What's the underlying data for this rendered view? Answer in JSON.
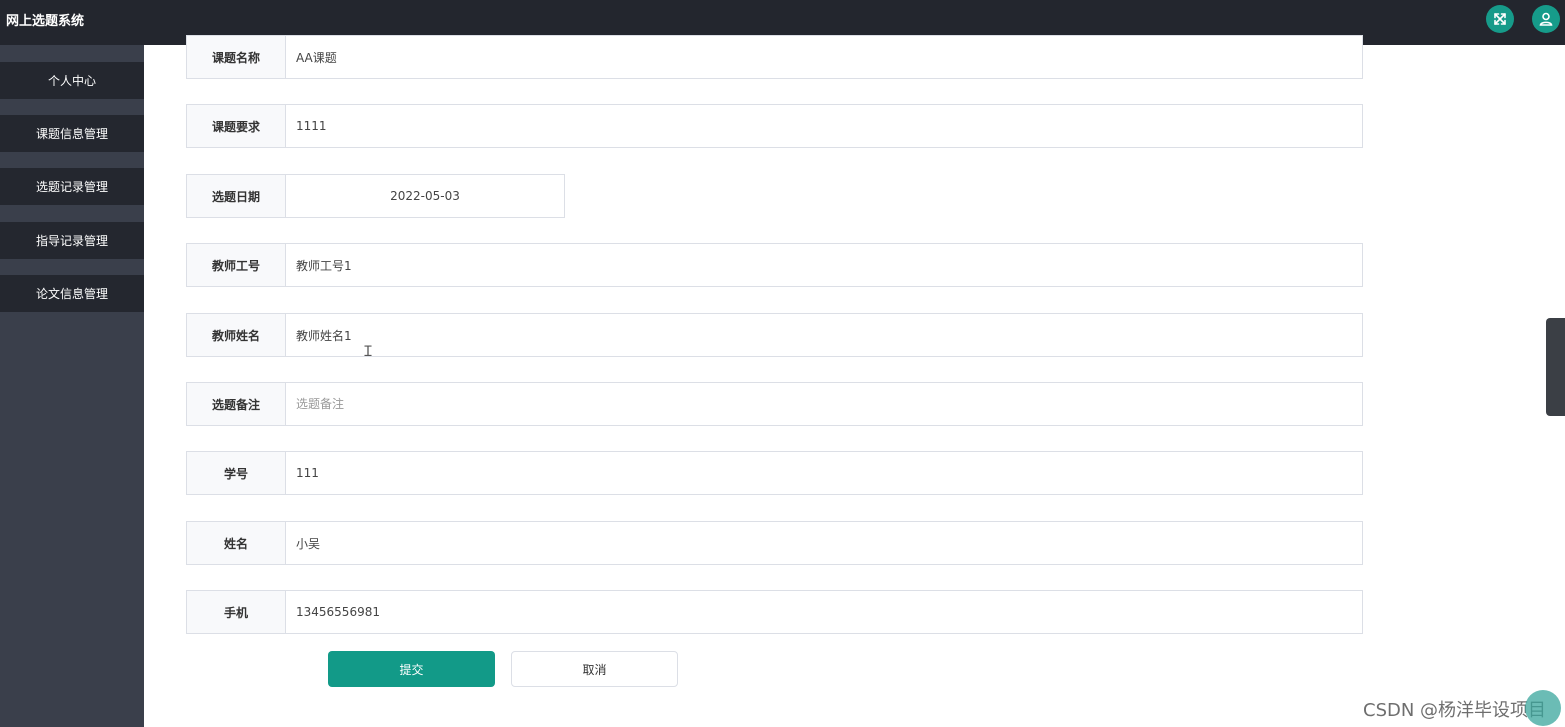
{
  "app": {
    "title": "网上选题系统"
  },
  "header": {
    "fullscreen_icon": "fullscreen-expand-icon",
    "user_icon": "user-avatar-icon",
    "accent": "#169b8a"
  },
  "sidebar": {
    "items": [
      {
        "label": "个人中心"
      },
      {
        "label": "课题信息管理"
      },
      {
        "label": "选题记录管理"
      },
      {
        "label": "指导记录管理"
      },
      {
        "label": "论文信息管理"
      }
    ]
  },
  "form": {
    "topic_name": {
      "label": "课题名称",
      "value": "AA课题"
    },
    "topic_requirement": {
      "label": "课题要求",
      "value": "1111"
    },
    "selection_date": {
      "label": "选题日期",
      "value": "2022-05-03"
    },
    "teacher_id": {
      "label": "教师工号",
      "value": "教师工号1"
    },
    "teacher_name": {
      "label": "教师姓名",
      "value": "教师姓名1"
    },
    "remark": {
      "label": "选题备注",
      "value": "",
      "placeholder": "选题备注"
    },
    "student_id": {
      "label": "学号",
      "value": "111"
    },
    "student_name": {
      "label": "姓名",
      "value": "小吴"
    },
    "phone": {
      "label": "手机",
      "value": "13456556981"
    }
  },
  "actions": {
    "submit_label": "提交",
    "cancel_label": "取消"
  },
  "overlay": {
    "watermark": "CSDN @杨洋毕设项目"
  }
}
